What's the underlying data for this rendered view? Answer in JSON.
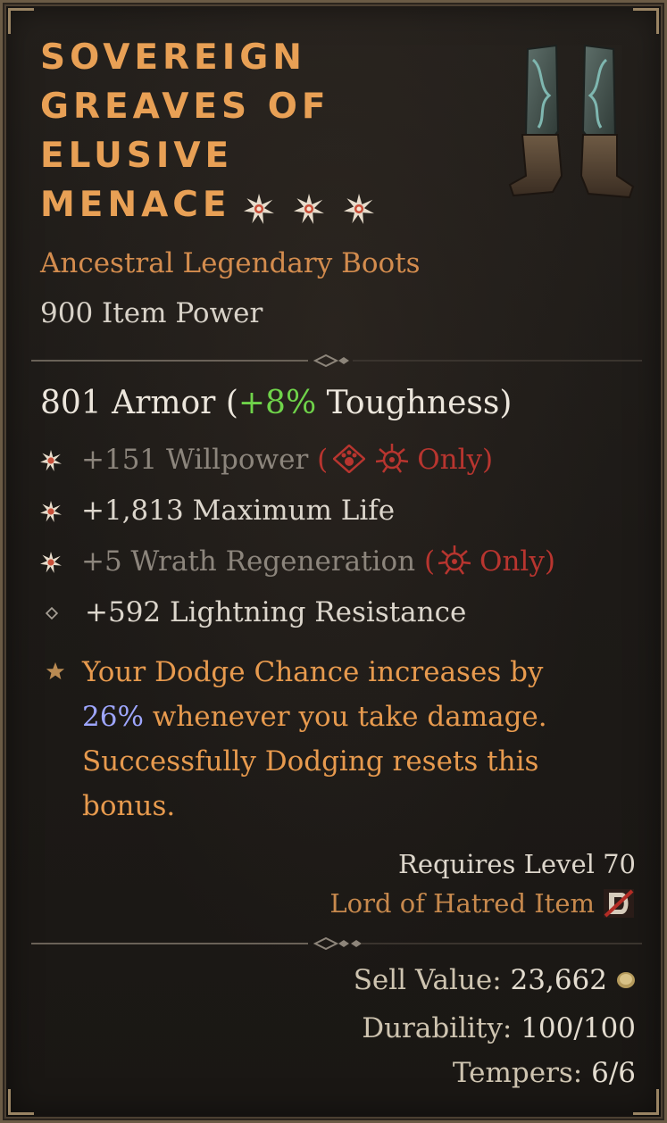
{
  "item": {
    "title_lines": [
      "SOVEREIGN",
      "GREAVES OF",
      "ELUSIVE",
      "MENACE"
    ],
    "greater_affix_stars": 3,
    "type": "Ancestral Legendary Boots",
    "item_power": "900 Item Power",
    "image_icon": "boots-icon"
  },
  "armor": {
    "value": "801 Armor (",
    "bonus": "+8%",
    "suffix": " Toughness)"
  },
  "affixes": [
    {
      "text": "+151 Willpower",
      "restriction_open": " (",
      "restriction_label": "Only)",
      "restriction_icons": [
        "druid-class-icon",
        "spiritborn-class-icon"
      ],
      "greater": true,
      "dimmed": true
    },
    {
      "text": "+1,813 Maximum Life",
      "greater": true,
      "dimmed": false
    },
    {
      "text": "+5 Wrath Regeneration",
      "restriction_open": " (",
      "restriction_label": "Only)",
      "restriction_icons": [
        "spiritborn-class-icon"
      ],
      "greater": true,
      "dimmed": true
    },
    {
      "text": "+592 Lightning Resistance",
      "greater": false,
      "dimmed": false
    }
  ],
  "legendary_power": {
    "before": "Your Dodge Chance increases by",
    "highlight": "26%",
    "after": " whenever you take damage. Successfully Dodging resets this bonus."
  },
  "requirements": {
    "level": "Requires Level 70",
    "expansion": "Lord of Hatred Item"
  },
  "footer": {
    "sell_label": "Sell Value: ",
    "sell_value": "23,662",
    "durability_label": "Durability: ",
    "durability_value": "100/100",
    "tempers_label": "Tempers: ",
    "tempers_value": "6/6"
  },
  "colors": {
    "title": "#e8a055",
    "legendary": "#d38c4e",
    "bonus_green": "#6fd34a",
    "restriction_red": "#b8352f",
    "highlight_blue": "#9ea6ff"
  }
}
